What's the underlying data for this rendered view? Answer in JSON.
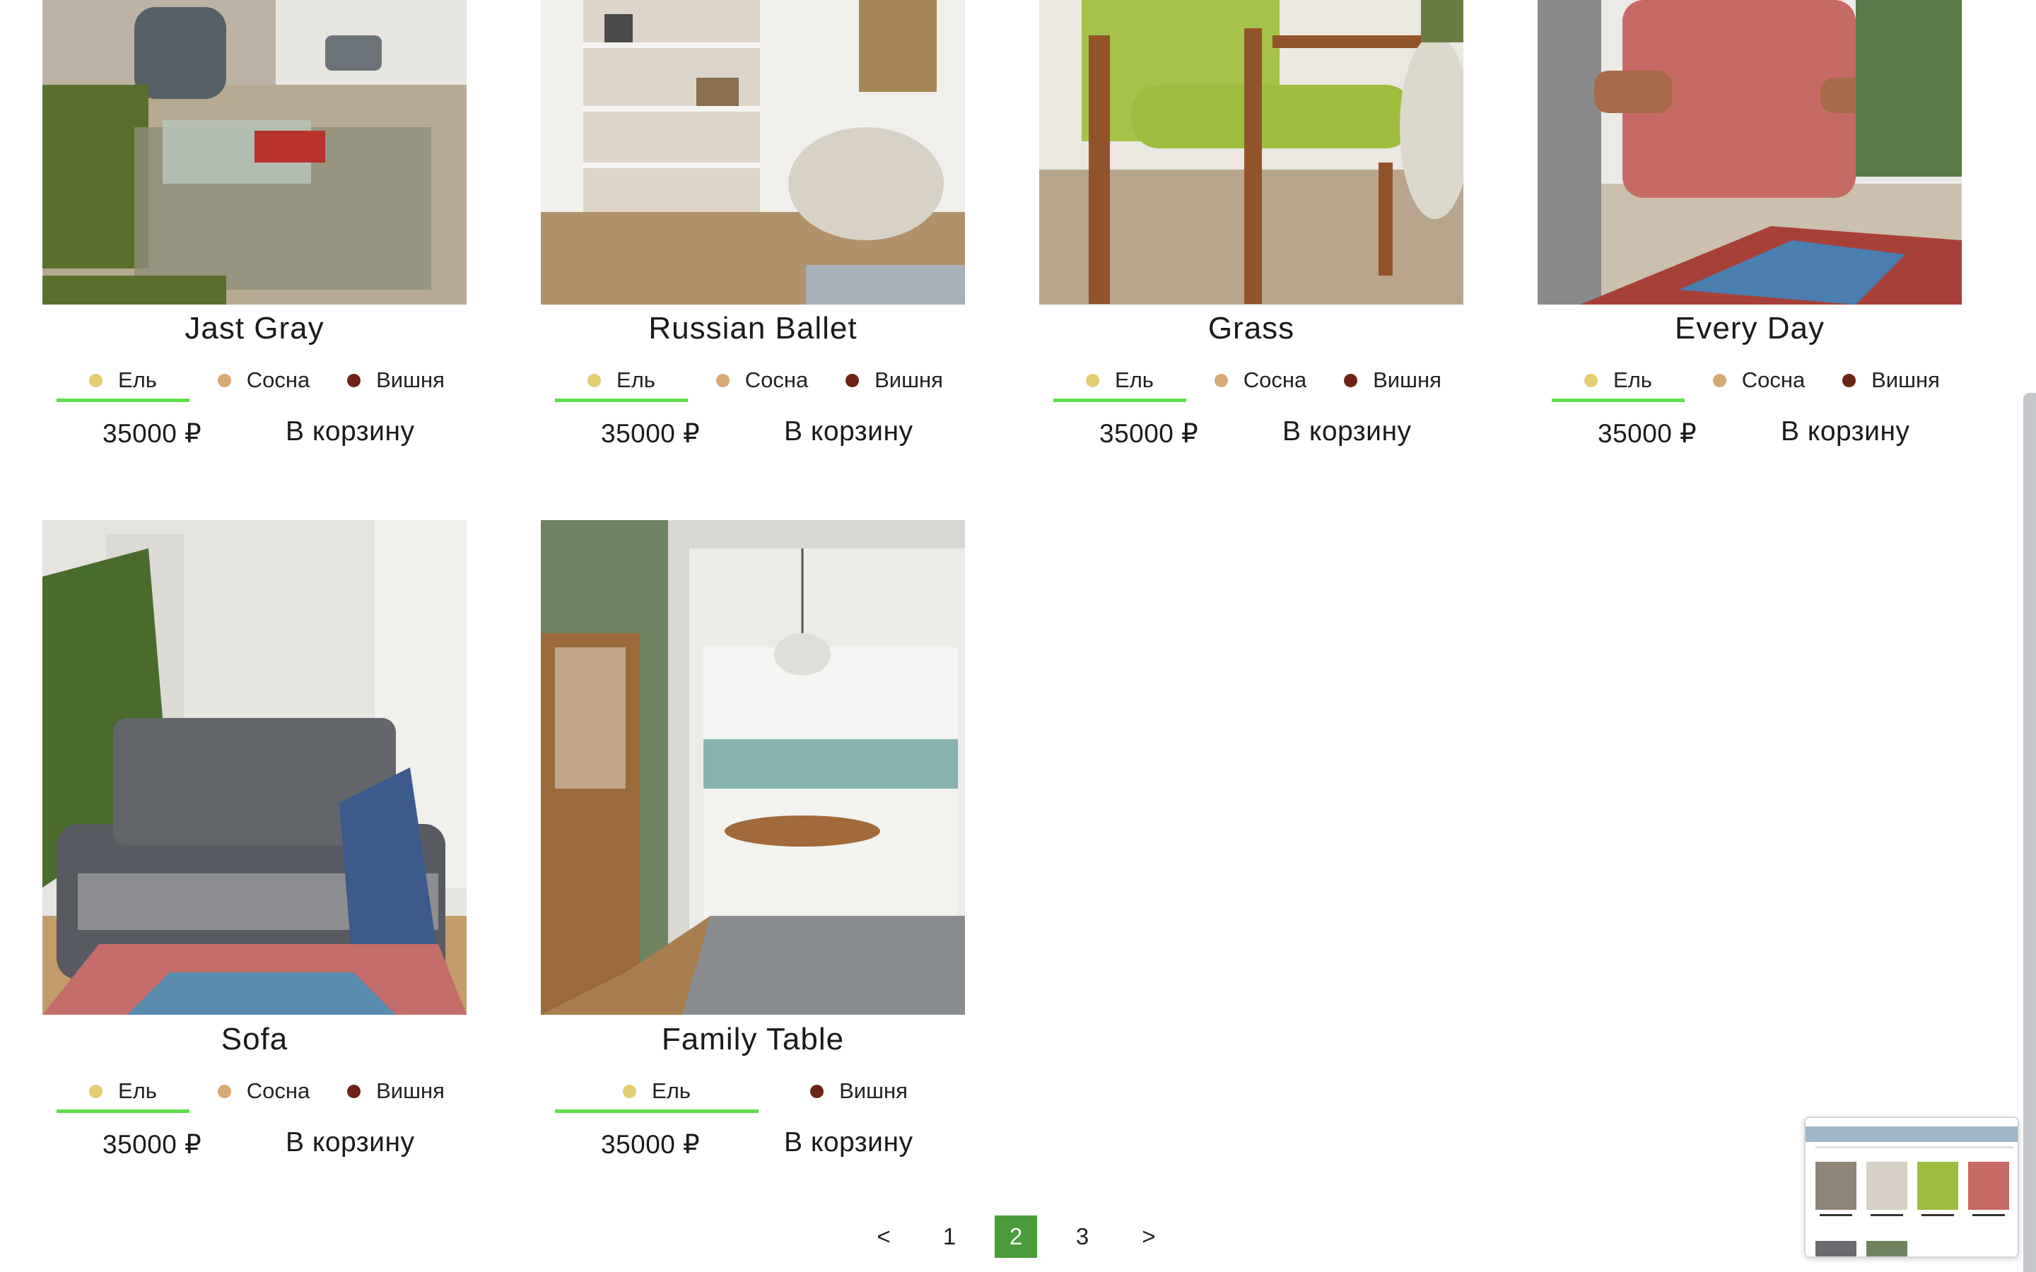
{
  "products": [
    {
      "name": "Jast Gray",
      "price": "35000 ₽",
      "cart_label": "В корзину",
      "variants": [
        {
          "label": "Ель",
          "color": "#e3cd70"
        },
        {
          "label": "Сосна",
          "color": "#d9a877"
        },
        {
          "label": "Вишня",
          "color": "#6e2414"
        }
      ]
    },
    {
      "name": "Russian Ballet",
      "price": "35000 ₽",
      "cart_label": "В корзину",
      "variants": [
        {
          "label": "Ель",
          "color": "#e3cd70"
        },
        {
          "label": "Сосна",
          "color": "#d9a877"
        },
        {
          "label": "Вишня",
          "color": "#6e2414"
        }
      ]
    },
    {
      "name": "Grass",
      "price": "35000 ₽",
      "cart_label": "В корзину",
      "variants": [
        {
          "label": "Ель",
          "color": "#e3cd70"
        },
        {
          "label": "Сосна",
          "color": "#d9a877"
        },
        {
          "label": "Вишня",
          "color": "#6e2414"
        }
      ]
    },
    {
      "name": "Every Day",
      "price": "35000 ₽",
      "cart_label": "В корзину",
      "variants": [
        {
          "label": "Ель",
          "color": "#e3cd70"
        },
        {
          "label": "Сосна",
          "color": "#d9a877"
        },
        {
          "label": "Вишня",
          "color": "#6e2414"
        }
      ]
    },
    {
      "name": "Sofa",
      "price": "35000 ₽",
      "cart_label": "В корзину",
      "variants": [
        {
          "label": "Ель",
          "color": "#e3cd70"
        },
        {
          "label": "Сосна",
          "color": "#d9a877"
        },
        {
          "label": "Вишня",
          "color": "#6e2414"
        }
      ]
    },
    {
      "name": "Family Table",
      "price": "35000 ₽",
      "cart_label": "В корзину",
      "variants": [
        {
          "label": "Ель",
          "color": "#e3cd70"
        },
        {
          "label": "Вишня",
          "color": "#6e2414"
        }
      ]
    }
  ],
  "pagination": {
    "prev": "<",
    "pages": [
      "1",
      "2",
      "3"
    ],
    "current": "2",
    "next": ">"
  },
  "colors": {
    "active_underline": "#5ee04a",
    "active_page": "#4a9c3a"
  }
}
